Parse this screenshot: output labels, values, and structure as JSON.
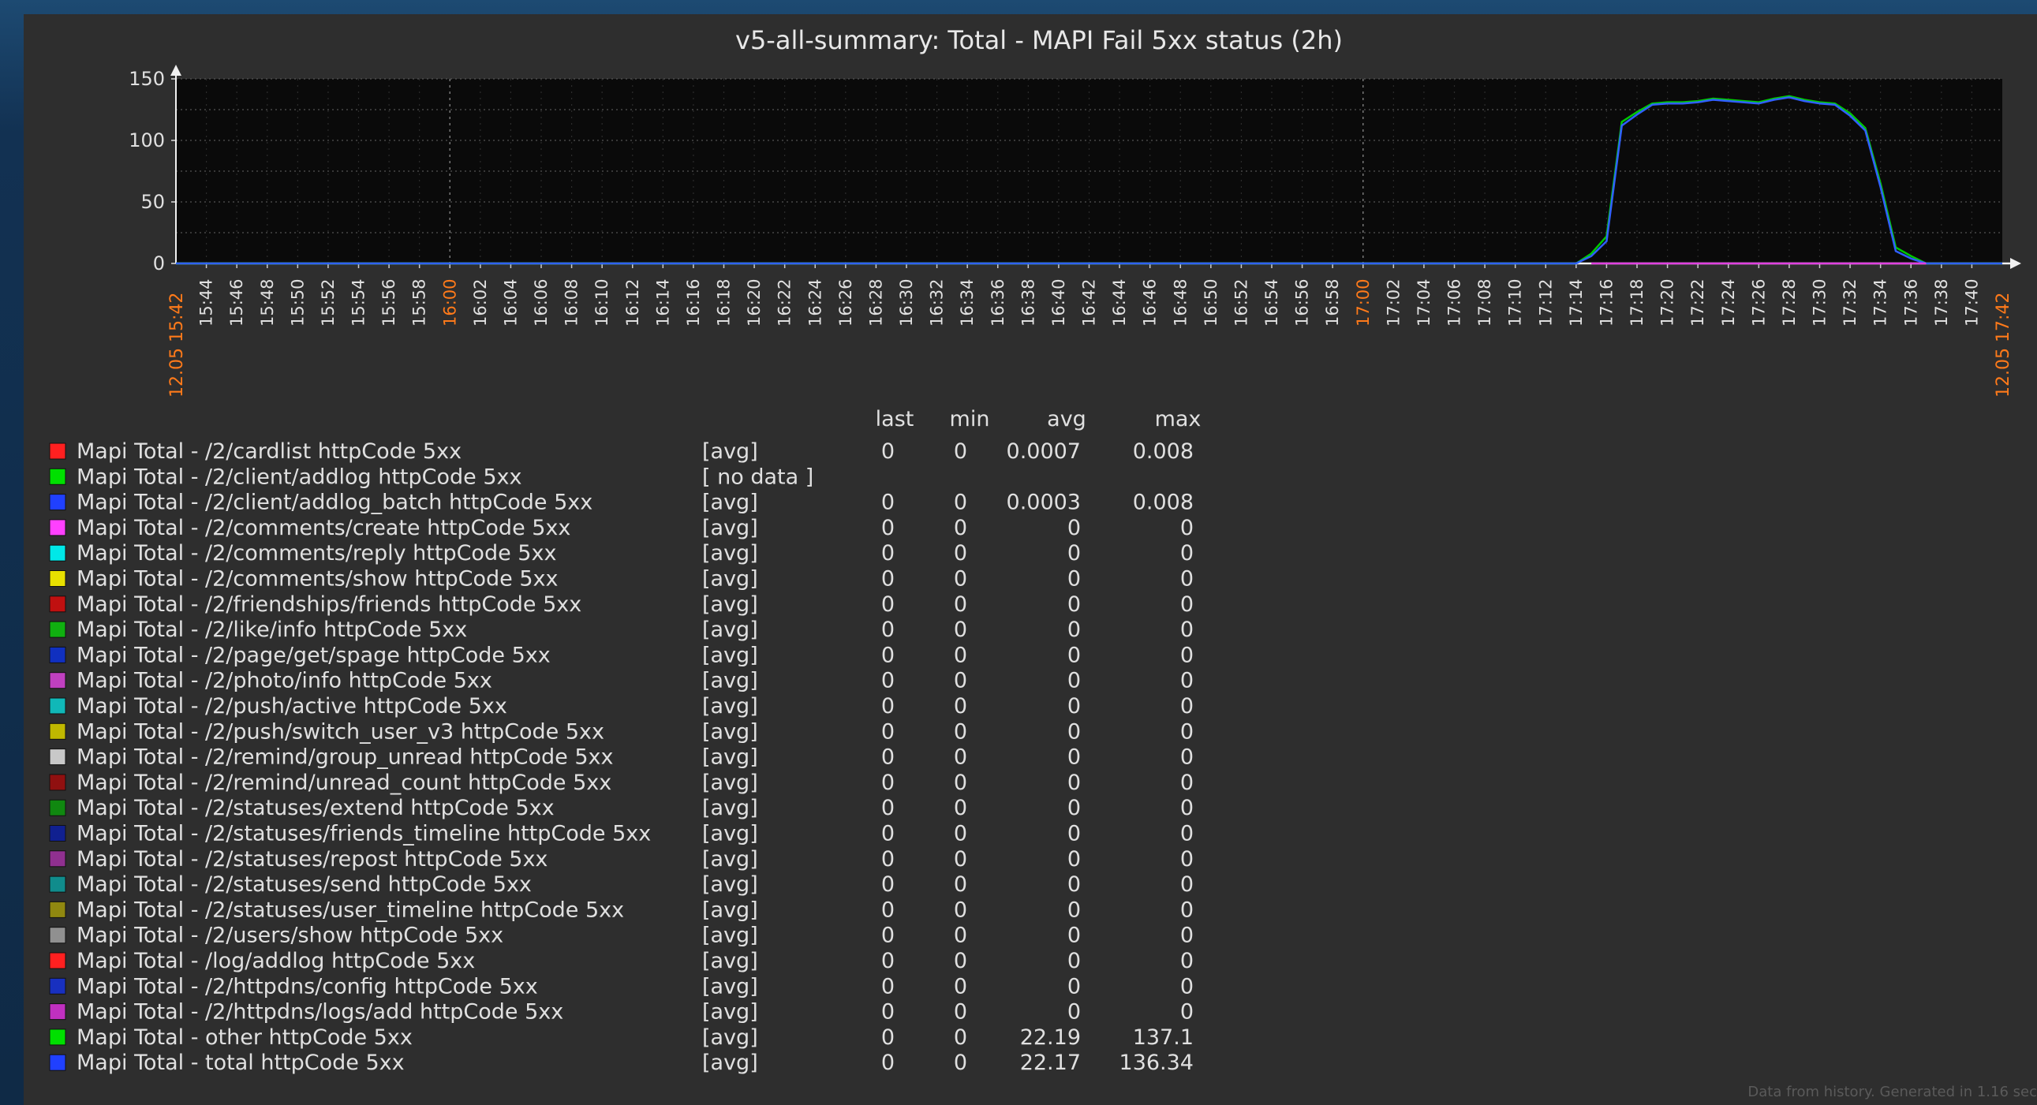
{
  "chart_data": {
    "type": "line",
    "title": "v5-all-summary: Total - MAPI Fail 5xx status (2h)",
    "yticks": [
      "0",
      "50",
      "100",
      "150"
    ],
    "ylim": [
      0,
      150
    ],
    "x_ticks": [
      "15:44",
      "15:46",
      "15:48",
      "15:50",
      "15:52",
      "15:54",
      "15:56",
      "15:58",
      "16:00",
      "16:02",
      "16:04",
      "16:06",
      "16:08",
      "16:10",
      "16:12",
      "16:14",
      "16:16",
      "16:18",
      "16:20",
      "16:22",
      "16:24",
      "16:26",
      "16:28",
      "16:30",
      "16:32",
      "16:34",
      "16:36",
      "16:38",
      "16:40",
      "16:42",
      "16:44",
      "16:46",
      "16:48",
      "16:50",
      "16:52",
      "16:54",
      "16:56",
      "16:58",
      "17:00",
      "17:02",
      "17:04",
      "17:06",
      "17:08",
      "17:10",
      "17:12",
      "17:14",
      "17:16",
      "17:18",
      "17:20",
      "17:22",
      "17:24",
      "17:26",
      "17:28",
      "17:30",
      "17:32",
      "17:34",
      "17:36",
      "17:38",
      "17:40"
    ],
    "x_ticks_highlight": [
      "16:00",
      "17:00"
    ],
    "x_start_label": "12.05 15:42",
    "x_end_label": "12.05 17:42",
    "x_range_minutes": [
      0,
      120
    ],
    "grid": true,
    "series": [
      {
        "name": "Mapi Total - other httpCode 5xx",
        "color": "#00c800",
        "points": [
          [
            0,
            0
          ],
          [
            90,
            0
          ],
          [
            92,
            0
          ],
          [
            93,
            8
          ],
          [
            94,
            22
          ],
          [
            95,
            115
          ],
          [
            96,
            123
          ],
          [
            97,
            130
          ],
          [
            98,
            131
          ],
          [
            99,
            131
          ],
          [
            100,
            132
          ],
          [
            101,
            134
          ],
          [
            102,
            133
          ],
          [
            103,
            132
          ],
          [
            104,
            131
          ],
          [
            105,
            134
          ],
          [
            106,
            136
          ],
          [
            107,
            133
          ],
          [
            108,
            131
          ],
          [
            109,
            130
          ],
          [
            110,
            122
          ],
          [
            111,
            110
          ],
          [
            112,
            65
          ],
          [
            113,
            13
          ],
          [
            114,
            6
          ],
          [
            115,
            0
          ],
          [
            120,
            0
          ]
        ]
      },
      {
        "name": "Mapi Total - total httpCode 5xx",
        "color": "#3060ff",
        "points": [
          [
            0,
            0
          ],
          [
            90,
            0
          ],
          [
            92,
            0
          ],
          [
            93,
            6
          ],
          [
            94,
            18
          ],
          [
            95,
            112
          ],
          [
            96,
            121
          ],
          [
            97,
            129
          ],
          [
            98,
            130
          ],
          [
            99,
            130
          ],
          [
            100,
            131
          ],
          [
            101,
            133
          ],
          [
            102,
            132
          ],
          [
            103,
            131
          ],
          [
            104,
            130
          ],
          [
            105,
            133
          ],
          [
            106,
            135
          ],
          [
            107,
            132
          ],
          [
            108,
            130
          ],
          [
            109,
            129
          ],
          [
            110,
            120
          ],
          [
            111,
            108
          ],
          [
            112,
            62
          ],
          [
            113,
            10
          ],
          [
            114,
            4
          ],
          [
            115,
            0
          ],
          [
            120,
            0
          ]
        ]
      },
      {
        "name": "Mapi Total - /2/httpdns/logs/add httpCode 5xx",
        "color": "#e040e0",
        "points": [
          [
            93,
            0
          ],
          [
            115,
            0
          ]
        ]
      }
    ]
  },
  "legend": {
    "headers": {
      "last": "last",
      "min": "min",
      "avg": "avg",
      "max": "max"
    },
    "rows": [
      {
        "name": "Mapi Total - /2/cardlist httpCode 5xx",
        "color": "#ff2020",
        "func": "[avg]",
        "last": "0",
        "min": "0",
        "avg": "0.0007",
        "max": "0.008"
      },
      {
        "name": "Mapi Total - /2/client/addlog httpCode 5xx",
        "color": "#00e000",
        "func": "[ no data ]",
        "last": "",
        "min": "",
        "avg": "",
        "max": ""
      },
      {
        "name": "Mapi Total - /2/client/addlog_batch httpCode 5xx",
        "color": "#2040ff",
        "func": "[avg]",
        "last": "0",
        "min": "0",
        "avg": "0.0003",
        "max": "0.008"
      },
      {
        "name": "Mapi Total - /2/comments/create httpCode 5xx",
        "color": "#ff40ff",
        "func": "[avg]",
        "last": "0",
        "min": "0",
        "avg": "0",
        "max": "0"
      },
      {
        "name": "Mapi Total - /2/comments/reply httpCode 5xx",
        "color": "#00e8e8",
        "func": "[avg]",
        "last": "0",
        "min": "0",
        "avg": "0",
        "max": "0"
      },
      {
        "name": "Mapi Total - /2/comments/show httpCode 5xx",
        "color": "#e8e000",
        "func": "[avg]",
        "last": "0",
        "min": "0",
        "avg": "0",
        "max": "0"
      },
      {
        "name": "Mapi Total - /2/friendships/friends httpCode 5xx",
        "color": "#c01010",
        "func": "[avg]",
        "last": "0",
        "min": "0",
        "avg": "0",
        "max": "0"
      },
      {
        "name": "Mapi Total - /2/like/info httpCode 5xx",
        "color": "#10b010",
        "func": "[avg]",
        "last": "0",
        "min": "0",
        "avg": "0",
        "max": "0"
      },
      {
        "name": "Mapi Total - /2/page/get/spage httpCode 5xx",
        "color": "#1030c0",
        "func": "[avg]",
        "last": "0",
        "min": "0",
        "avg": "0",
        "max": "0"
      },
      {
        "name": "Mapi Total - /2/photo/info httpCode 5xx",
        "color": "#c040c0",
        "func": "[avg]",
        "last": "0",
        "min": "0",
        "avg": "0",
        "max": "0"
      },
      {
        "name": "Mapi Total - /2/push/active httpCode 5xx",
        "color": "#10b8b8",
        "func": "[avg]",
        "last": "0",
        "min": "0",
        "avg": "0",
        "max": "0"
      },
      {
        "name": "Mapi Total - /2/push/switch_user_v3 httpCode 5xx",
        "color": "#c0b800",
        "func": "[avg]",
        "last": "0",
        "min": "0",
        "avg": "0",
        "max": "0"
      },
      {
        "name": "Mapi Total - /2/remind/group_unread httpCode 5xx",
        "color": "#c8c8c8",
        "func": "[avg]",
        "last": "0",
        "min": "0",
        "avg": "0",
        "max": "0"
      },
      {
        "name": "Mapi Total - /2/remind/unread_count httpCode 5xx",
        "color": "#901010",
        "func": "[avg]",
        "last": "0",
        "min": "0",
        "avg": "0",
        "max": "0"
      },
      {
        "name": "Mapi Total - /2/statuses/extend httpCode 5xx",
        "color": "#108810",
        "func": "[avg]",
        "last": "0",
        "min": "0",
        "avg": "0",
        "max": "0"
      },
      {
        "name": "Mapi Total - /2/statuses/friends_timeline httpCode 5xx",
        "color": "#102090",
        "func": "[avg]",
        "last": "0",
        "min": "0",
        "avg": "0",
        "max": "0"
      },
      {
        "name": "Mapi Total - /2/statuses/repost httpCode 5xx",
        "color": "#903090",
        "func": "[avg]",
        "last": "0",
        "min": "0",
        "avg": "0",
        "max": "0"
      },
      {
        "name": "Mapi Total - /2/statuses/send httpCode 5xx",
        "color": "#108c8c",
        "func": "[avg]",
        "last": "0",
        "min": "0",
        "avg": "0",
        "max": "0"
      },
      {
        "name": "Mapi Total - /2/statuses/user_timeline httpCode 5xx",
        "color": "#908810",
        "func": "[avg]",
        "last": "0",
        "min": "0",
        "avg": "0",
        "max": "0"
      },
      {
        "name": "Mapi Total - /2/users/show httpCode 5xx",
        "color": "#909090",
        "func": "[avg]",
        "last": "0",
        "min": "0",
        "avg": "0",
        "max": "0"
      },
      {
        "name": "Mapi Total - /log/addlog httpCode 5xx",
        "color": "#ff2020",
        "func": "[avg]",
        "last": "0",
        "min": "0",
        "avg": "0",
        "max": "0"
      },
      {
        "name": "Mapi Total - /2/httpdns/config httpCode 5xx",
        "color": "#1830c0",
        "func": "[avg]",
        "last": "0",
        "min": "0",
        "avg": "0",
        "max": "0"
      },
      {
        "name": "Mapi Total - /2/httpdns/logs/add httpCode 5xx",
        "color": "#c030c0",
        "func": "[avg]",
        "last": "0",
        "min": "0",
        "avg": "0",
        "max": "0"
      },
      {
        "name": "Mapi Total - other httpCode 5xx",
        "color": "#00e000",
        "func": "[avg]",
        "last": "0",
        "min": "0",
        "avg": "22.19",
        "max": "137.1"
      },
      {
        "name": "Mapi Total - total httpCode 5xx",
        "color": "#2040ff",
        "func": "[avg]",
        "last": "0",
        "min": "0",
        "avg": "22.17",
        "max": "136.34"
      }
    ]
  },
  "footer": "Data from history. Generated in 1.16 sec"
}
